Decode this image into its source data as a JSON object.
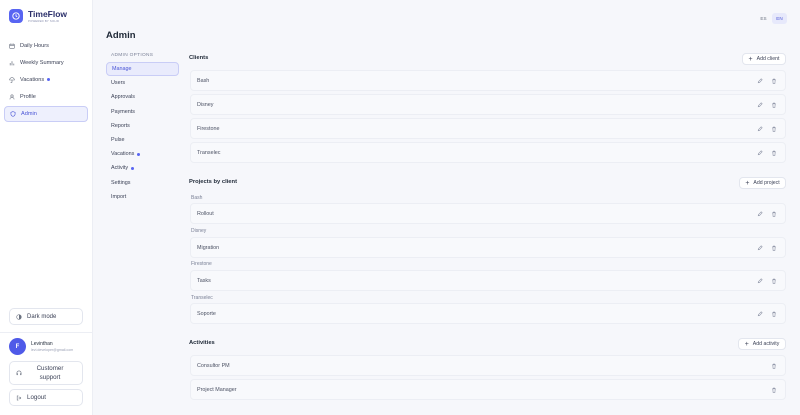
{
  "brand": {
    "name": "TimeFlow",
    "tagline": "POWERED BY SOLID"
  },
  "sidebar": {
    "items": [
      {
        "label": "Daily Hours",
        "icon": "calendar-icon"
      },
      {
        "label": "Weekly Summary",
        "icon": "bar-chart-icon"
      },
      {
        "label": "Vacations",
        "icon": "umbrella-icon",
        "dot": true
      },
      {
        "label": "Profile",
        "icon": "user-icon"
      },
      {
        "label": "Admin",
        "icon": "shield-icon",
        "active": true
      }
    ],
    "dark_mode_label": "Dark mode",
    "user": {
      "initial": "F",
      "name": "Levinthan",
      "email": "levi.developer@gmail.com"
    },
    "support_label": "Customer support",
    "logout_label": "Logout"
  },
  "header": {
    "title": "Admin",
    "lang": [
      "ES",
      "EN"
    ],
    "lang_active": "EN"
  },
  "admin_options": {
    "title": "ADMIN OPTIONS",
    "items": [
      {
        "label": "Manage",
        "active": true
      },
      {
        "label": "Users"
      },
      {
        "label": "Approvals"
      },
      {
        "label": "Payments"
      },
      {
        "label": "Reports"
      },
      {
        "label": "Pulse"
      },
      {
        "label": "Vacations",
        "dot": true
      },
      {
        "label": "Activity",
        "dot": true
      },
      {
        "label": "Settings"
      },
      {
        "label": "Import"
      }
    ]
  },
  "clients": {
    "title": "Clients",
    "add_label": "Add client",
    "rows": [
      "Bash",
      "Disney",
      "Firestone",
      "Transelec"
    ]
  },
  "projects": {
    "title": "Projects by client",
    "add_label": "Add project",
    "groups": [
      {
        "client": "Bash",
        "project": "Rollout"
      },
      {
        "client": "Disney",
        "project": "Migration"
      },
      {
        "client": "Firestone",
        "project": "Tasks"
      },
      {
        "client": "Transelec",
        "project": "Soporte"
      }
    ]
  },
  "activities": {
    "title": "Activities",
    "add_label": "Add activity",
    "rows": [
      "Consultor PM",
      "Project Manager"
    ]
  },
  "colors": {
    "accent": "#5865f2",
    "accent_soft": "#eef0fd",
    "row_bg": "#f8f9fc"
  }
}
